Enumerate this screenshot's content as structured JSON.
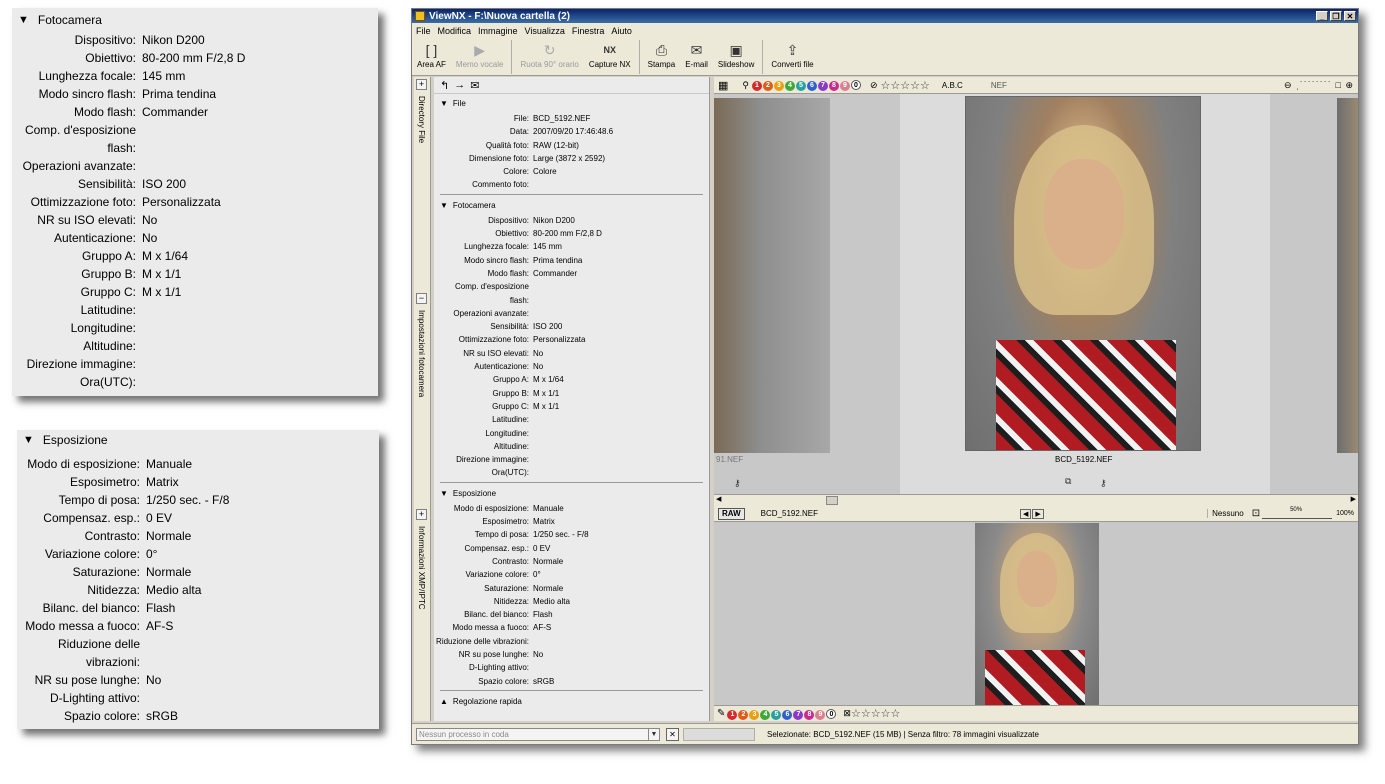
{
  "zoom_fotocamera": {
    "title": "Fotocamera",
    "rows": [
      {
        "label": "Dispositivo:",
        "value": "Nikon D200"
      },
      {
        "label": "Obiettivo:",
        "value": "80-200 mm F/2,8 D"
      },
      {
        "label": "Lunghezza focale:",
        "value": "145 mm"
      },
      {
        "label": "Modo sincro flash:",
        "value": "Prima tendina"
      },
      {
        "label": "Modo flash:",
        "value": "Commander"
      },
      {
        "label": "Comp. d'esposizione flash:",
        "value": ""
      },
      {
        "label": "Operazioni avanzate:",
        "value": ""
      },
      {
        "label": "Sensibilità:",
        "value": "ISO 200"
      },
      {
        "label": "Ottimizzazione foto:",
        "value": "Personalizzata"
      },
      {
        "label": "NR su ISO elevati:",
        "value": "No"
      },
      {
        "label": "Autenticazione:",
        "value": "No"
      },
      {
        "label": "Gruppo A:",
        "value": "M x 1/64"
      },
      {
        "label": "Gruppo B:",
        "value": "M x 1/1"
      },
      {
        "label": "Gruppo C:",
        "value": "M x 1/1"
      },
      {
        "label": "Latitudine:",
        "value": ""
      },
      {
        "label": "Longitudine:",
        "value": ""
      },
      {
        "label": "Altitudine:",
        "value": ""
      },
      {
        "label": "Direzione immagine:",
        "value": ""
      },
      {
        "label": "Ora(UTC):",
        "value": ""
      }
    ]
  },
  "zoom_esposizione": {
    "title": "Esposizione",
    "rows": [
      {
        "label": "Modo di esposizione:",
        "value": "Manuale"
      },
      {
        "label": "Esposimetro:",
        "value": "Matrix"
      },
      {
        "label": "Tempo di posa:",
        "value": "1/250 sec. - F/8"
      },
      {
        "label": "Compensaz. esp.:",
        "value": "0 EV"
      },
      {
        "label": "Contrasto:",
        "value": "Normale"
      },
      {
        "label": "Variazione colore:",
        "value": "0°"
      },
      {
        "label": "Saturazione:",
        "value": "Normale"
      },
      {
        "label": "Nitidezza:",
        "value": "Medio alta"
      },
      {
        "label": "Bilanc. del bianco:",
        "value": "Flash"
      },
      {
        "label": "Modo messa a fuoco:",
        "value": "AF-S"
      },
      {
        "label": "Riduzione delle vibrazioni:",
        "value": ""
      },
      {
        "label": "NR su pose lunghe:",
        "value": "No"
      },
      {
        "label": "D-Lighting attivo:",
        "value": ""
      },
      {
        "label": "Spazio colore:",
        "value": "sRGB"
      }
    ]
  },
  "window": {
    "title": "ViewNX - F:\\Nuova cartella (2)",
    "buttons": {
      "minimize": "_",
      "restore": "❐",
      "close": "✕"
    }
  },
  "menu": [
    "File",
    "Modifica",
    "Immagine",
    "Visualizza",
    "Finestra",
    "Aiuto"
  ],
  "toolbar": [
    {
      "label": "Area AF",
      "icon": "[ ]",
      "enabled": true
    },
    {
      "label": "Memo vocale",
      "icon": "▶",
      "enabled": false
    },
    {
      "label": "Ruota 90° orario",
      "icon": "↻",
      "enabled": false
    },
    {
      "label": "Capture NX",
      "icon": "NX",
      "enabled": true
    },
    {
      "label": "Stampa",
      "icon": "⎙",
      "enabled": true
    },
    {
      "label": "E-mail",
      "icon": "✉",
      "enabled": true
    },
    {
      "label": "Slideshow",
      "icon": "▣",
      "enabled": true
    },
    {
      "label": "Converti file",
      "icon": "⇪",
      "enabled": true
    }
  ],
  "vertical_tabs": [
    "Directory File",
    "Impostazioni fotocamera",
    "Informazioni XMP/IPTC"
  ],
  "meta_file": {
    "title": "File",
    "rows": [
      {
        "label": "File:",
        "value": "BCD_5192.NEF"
      },
      {
        "label": "Data:",
        "value": "2007/09/20 17:46:48.6"
      },
      {
        "label": "Qualità foto:",
        "value": "RAW (12-bit)"
      },
      {
        "label": "Dimensione foto:",
        "value": "Large (3872 x 2592)"
      },
      {
        "label": "Colore:",
        "value": "Colore"
      },
      {
        "label": "Commento foto:",
        "value": ""
      }
    ]
  },
  "meta_fotocamera": {
    "title": "Fotocamera",
    "rows": [
      {
        "label": "Dispositivo:",
        "value": "Nikon D200"
      },
      {
        "label": "Obiettivo:",
        "value": "80-200 mm F/2,8 D"
      },
      {
        "label": "Lunghezza focale:",
        "value": "145 mm"
      },
      {
        "label": "Modo sincro flash:",
        "value": "Prima tendina"
      },
      {
        "label": "Modo flash:",
        "value": "Commander"
      },
      {
        "label": "Comp. d'esposizione flash:",
        "value": ""
      },
      {
        "label": "Operazioni avanzate:",
        "value": ""
      },
      {
        "label": "Sensibilità:",
        "value": "ISO 200"
      },
      {
        "label": "Ottimizzazione foto:",
        "value": "Personalizzata"
      },
      {
        "label": "NR su ISO elevati:",
        "value": "No"
      },
      {
        "label": "Autenticazione:",
        "value": "No"
      },
      {
        "label": "Gruppo A:",
        "value": "M x 1/64"
      },
      {
        "label": "Gruppo B:",
        "value": "M x 1/1"
      },
      {
        "label": "Gruppo C:",
        "value": "M x 1/1"
      },
      {
        "label": "Latitudine:",
        "value": ""
      },
      {
        "label": "Longitudine:",
        "value": ""
      },
      {
        "label": "Altitudine:",
        "value": ""
      },
      {
        "label": "Direzione immagine:",
        "value": ""
      },
      {
        "label": "Ora(UTC):",
        "value": ""
      }
    ]
  },
  "meta_esposizione": {
    "title": "Esposizione",
    "rows": [
      {
        "label": "Modo di esposizione:",
        "value": "Manuale"
      },
      {
        "label": "Esposimetro:",
        "value": "Matrix"
      },
      {
        "label": "Tempo di posa:",
        "value": "1/250 sec. - F/8"
      },
      {
        "label": "Compensaz. esp.:",
        "value": "0 EV"
      },
      {
        "label": "Contrasto:",
        "value": "Normale"
      },
      {
        "label": "Variazione colore:",
        "value": "0°"
      },
      {
        "label": "Saturazione:",
        "value": "Normale"
      },
      {
        "label": "Nitidezza:",
        "value": "Medio alta"
      },
      {
        "label": "Bilanc. del bianco:",
        "value": "Flash"
      },
      {
        "label": "Modo messa a fuoco:",
        "value": "AF-S"
      },
      {
        "label": "Riduzione delle vibrazioni:",
        "value": ""
      },
      {
        "label": "NR su pose lunghe:",
        "value": "No"
      },
      {
        "label": "D-Lighting attivo:",
        "value": ""
      },
      {
        "label": "Spazio colore:",
        "value": "sRGB"
      }
    ]
  },
  "regolazione": "Regolazione rapida",
  "label_colors": [
    "#d42a2a",
    "#e05a1a",
    "#e8a010",
    "#3ea83a",
    "#2aa0a0",
    "#3060d0",
    "#8a38c8",
    "#c82a90",
    "#d88090"
  ],
  "label_numbers": [
    "1",
    "2",
    "3",
    "4",
    "5",
    "6",
    "7",
    "8",
    "9",
    "0"
  ],
  "viewer": {
    "abc": "A.B.C",
    "filter_ext": "NEF",
    "left_caption": "91.NEF",
    "selected_caption": "BCD_5192.NEF",
    "raw_badge": "RAW",
    "filename": "BCD_5192.NEF",
    "picture_control": "Nessuno",
    "zoom_mid": "50%",
    "zoom_max": "100%"
  },
  "status": {
    "process_placeholder": "Nessun processo in coda",
    "text": "Selezionate: BCD_5192.NEF (15 MB) | Senza filtro: 78 immagini visualizzate"
  }
}
